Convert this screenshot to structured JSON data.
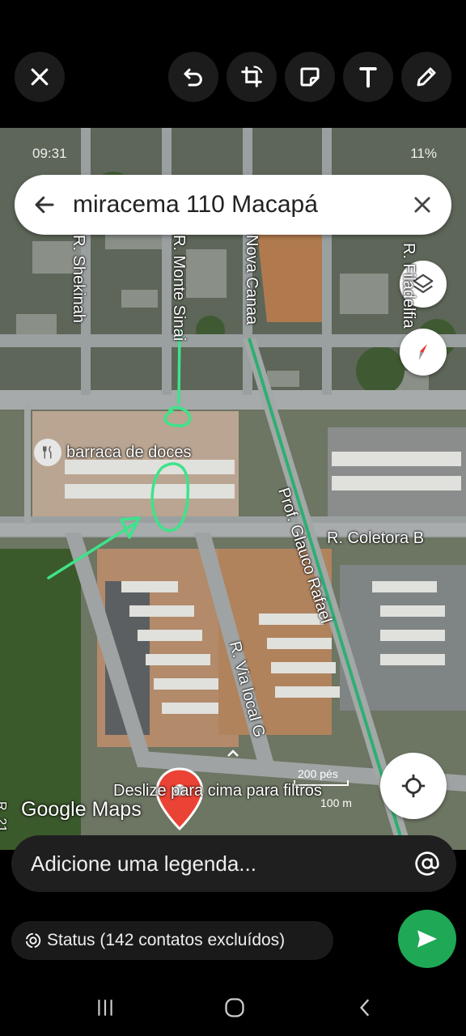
{
  "editor_toolbar": {
    "close_icon": "close-icon",
    "undo_icon": "undo-icon",
    "crop_rotate_icon": "crop-rotate-icon",
    "sticker_icon": "sticker-icon",
    "text_icon": "text-icon",
    "pencil_icon": "pencil-icon"
  },
  "phone_status": {
    "time": "09:31",
    "battery": "11%"
  },
  "maps": {
    "search_query": "miracema 110 Macapá",
    "streets": {
      "shekinah": "R. Shekinah",
      "monte_sinai": "R. Monte Sinai",
      "nova_canaa": "Nova Canaa",
      "filadelfia": "R. Filadelfia",
      "coletora_b": "R. Coletora B",
      "glauco_rafael": "Prof. Glauco Rafael",
      "via_local_g": "R. Via local G",
      "r_21": "R. 21"
    },
    "poi_label": "barraca de doces",
    "swipe_hint": "Deslize para cima para filtros",
    "scale_ft": "200 pés",
    "scale_m": "100 m",
    "logo": "Google Maps"
  },
  "caption": {
    "placeholder": "Adicione uma legenda..."
  },
  "status_audience": {
    "label": "Status (142 contatos excluídos)"
  },
  "colors": {
    "annotation": "#3ee38a",
    "send_button": "#1fa855",
    "route": "#2fae74"
  }
}
